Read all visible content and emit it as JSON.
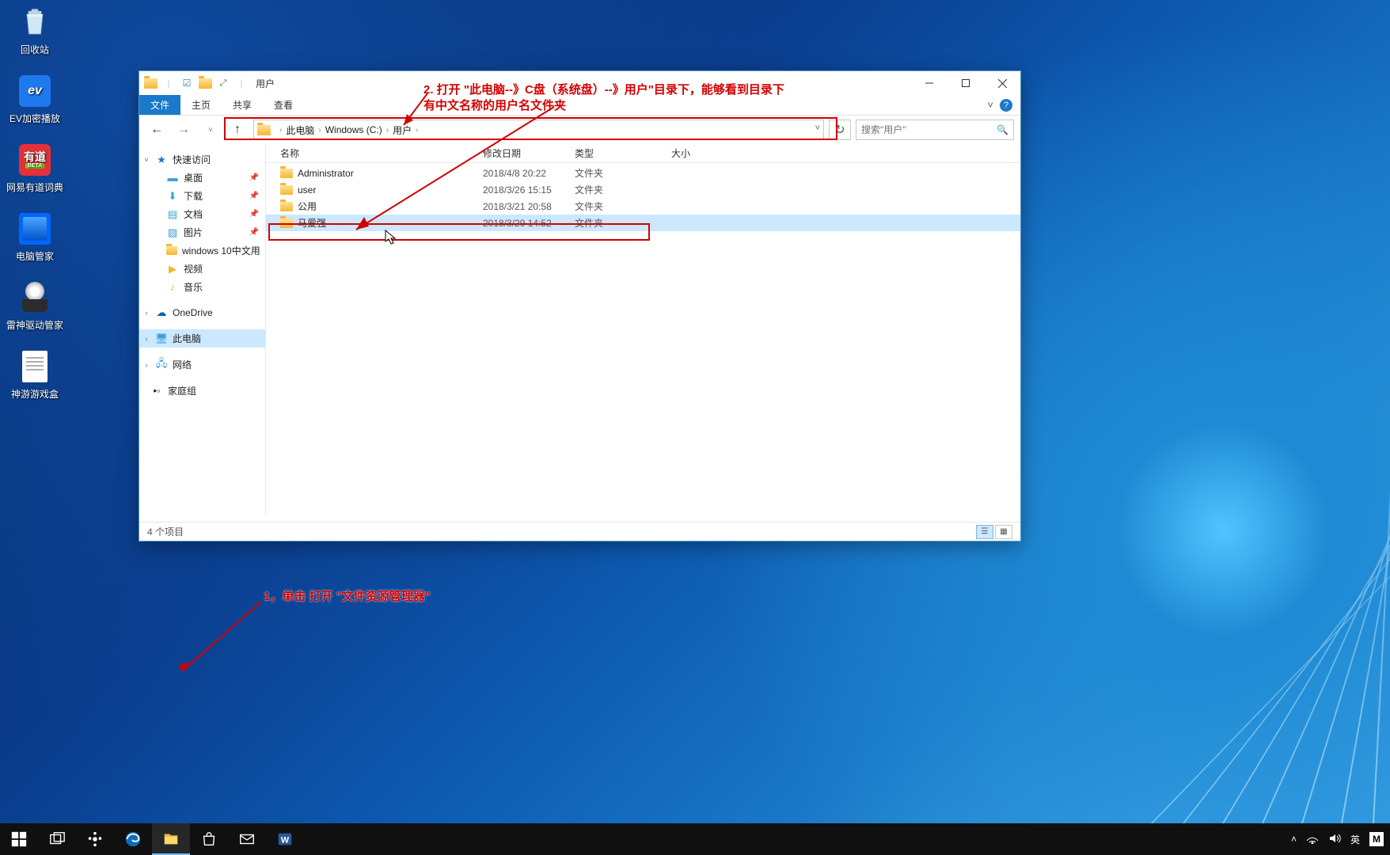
{
  "desktop_icons": [
    {
      "label": "回收站",
      "id": "recycle-bin"
    },
    {
      "label": "EV加密播放",
      "id": "ev-player"
    },
    {
      "label": "网易有道词典",
      "id": "youdao"
    },
    {
      "label": "电脑管家",
      "id": "pc-manager"
    },
    {
      "label": "雷神驱动管家",
      "id": "thunder-driver"
    },
    {
      "label": "神游游戏盒",
      "id": "game-box"
    }
  ],
  "explorer": {
    "title": "用户",
    "ribbon": {
      "file": "文件",
      "home": "主页",
      "share": "共享",
      "view": "查看"
    },
    "breadcrumb": [
      "此电脑",
      "Windows (C:)",
      "用户"
    ],
    "search_placeholder": "搜索\"用户\"",
    "nav": {
      "quick": {
        "label": "快速访问",
        "items": [
          "桌面",
          "下载",
          "文档",
          "图片",
          "windows 10中文用",
          "视频",
          "音乐"
        ]
      },
      "onedrive": "OneDrive",
      "thispc": "此电脑",
      "network": "网络",
      "homegroup": "家庭组"
    },
    "columns": {
      "name": "名称",
      "date": "修改日期",
      "type": "类型",
      "size": "大小"
    },
    "rows": [
      {
        "name": "Administrator",
        "date": "2018/4/8 20:22",
        "type": "文件夹"
      },
      {
        "name": "user",
        "date": "2018/3/26 15:15",
        "type": "文件夹"
      },
      {
        "name": "公用",
        "date": "2018/3/21 20:58",
        "type": "文件夹"
      },
      {
        "name": "马爱强",
        "date": "2018/3/29 14:52",
        "type": "文件夹",
        "selected": true
      }
    ],
    "status": "4 个项目"
  },
  "annotations": {
    "a1": "1，单击 打开 \"文件资源管理器\"",
    "a2": "2. 打开 \"此电脑--》C盘（系统盘）--》用户\"目录下，能够看到目录下有中文名称的用户名文件夹"
  },
  "tray": {
    "ime": "英",
    "m": "M"
  }
}
